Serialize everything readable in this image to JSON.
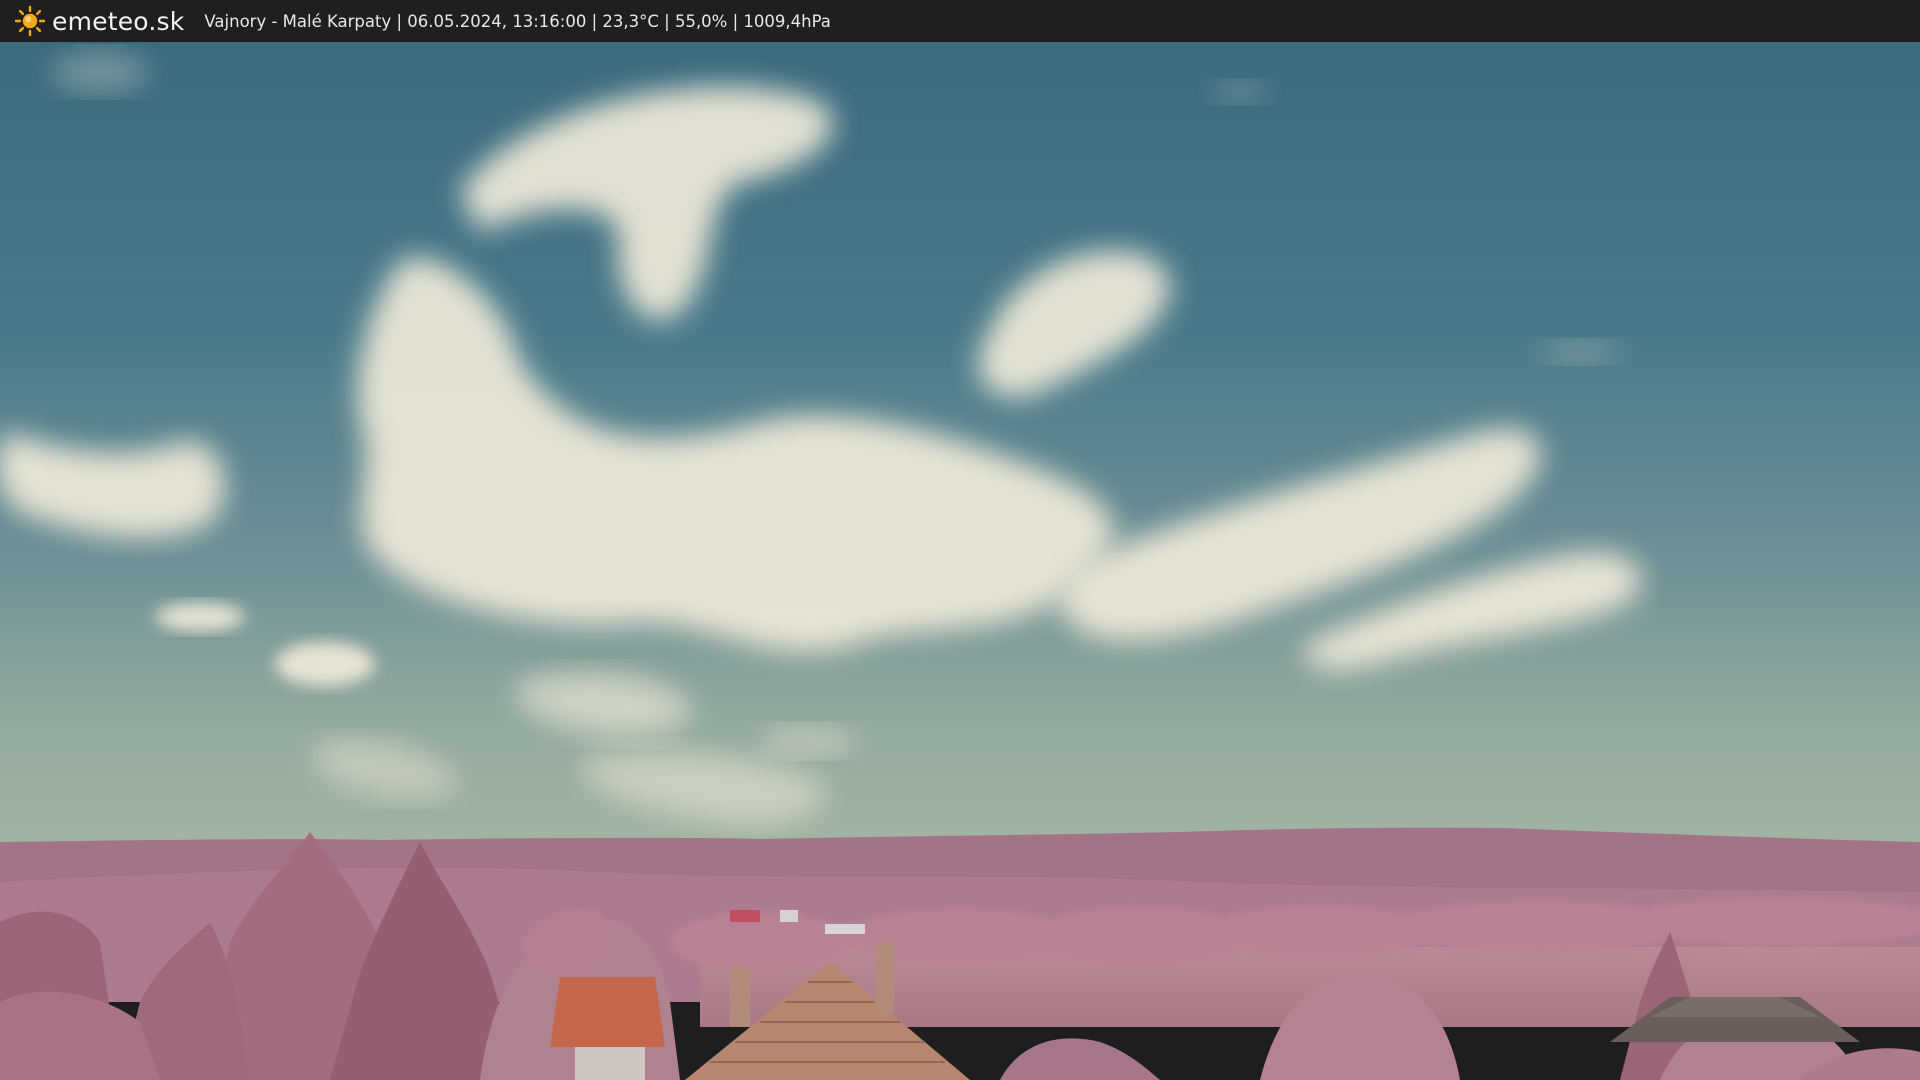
{
  "brand": {
    "name": "emeteo.sk",
    "icon": "sun-icon"
  },
  "caption": {
    "text": "Vajnory - Malé Karpaty | 06.05.2024, 13:16:00 | 23,3°C | 55,0% | 1009,4hPa"
  },
  "colors": {
    "topbar": "#1f1f1f",
    "sky_top": "#3a6b7d",
    "sky_horizon": "#9fb3a5",
    "cloud": "#f2ecdc",
    "hills": "#a8768a",
    "vegetation": "#b67e8e",
    "roof": "#c56a4c",
    "sun": "#f4a81c"
  }
}
